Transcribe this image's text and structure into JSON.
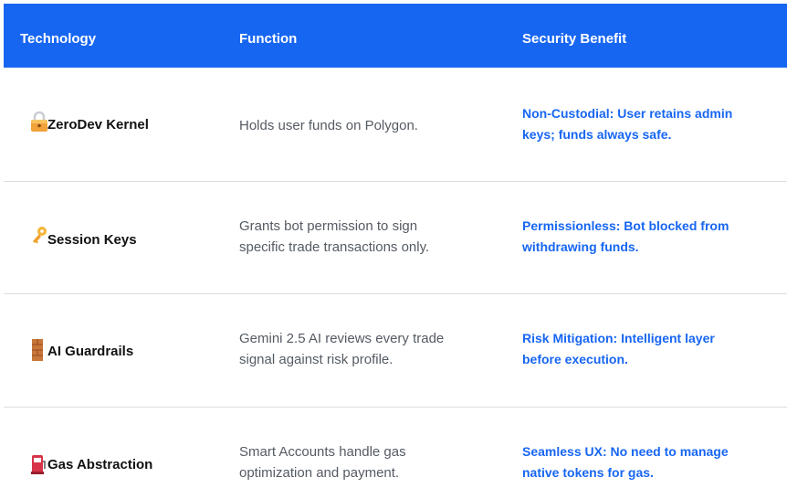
{
  "header": {
    "technology": "Technology",
    "function": "Function",
    "security_benefit": "Security Benefit"
  },
  "rows": [
    {
      "icon": "lock-icon",
      "technology": "ZeroDev Kernel",
      "function": "Holds user funds on Polygon.",
      "benefit_line1": "Non-Custodial: User retains admin",
      "benefit_line2": "keys; funds always safe."
    },
    {
      "icon": "key-icon",
      "technology": "Session Keys",
      "function_line1": "Grants bot permission to sign",
      "function_line2": "specific trade transactions only.",
      "benefit_line1": "Permissionless: Bot blocked from",
      "benefit_line2": "withdrawing funds."
    },
    {
      "icon": "brick-wall-icon",
      "technology": "AI Guardrails",
      "function_line1": "Gemini 2.5 AI reviews every trade",
      "function_line2": "signal against risk profile.",
      "benefit_line1": "Risk Mitigation: Intelligent layer",
      "benefit_line2": "before execution."
    },
    {
      "icon": "fuel-pump-icon",
      "technology": "Gas Abstraction",
      "function_line1": "Smart Accounts handle gas",
      "function_line2": "optimization and payment.",
      "benefit_line1": "Seamless UX: No need to manage",
      "benefit_line2": "native tokens for gas."
    }
  ],
  "colors": {
    "header_bg": "#1766f2",
    "benefit_text": "#1766f2",
    "function_text": "#555b63",
    "divider": "#dadde2"
  }
}
